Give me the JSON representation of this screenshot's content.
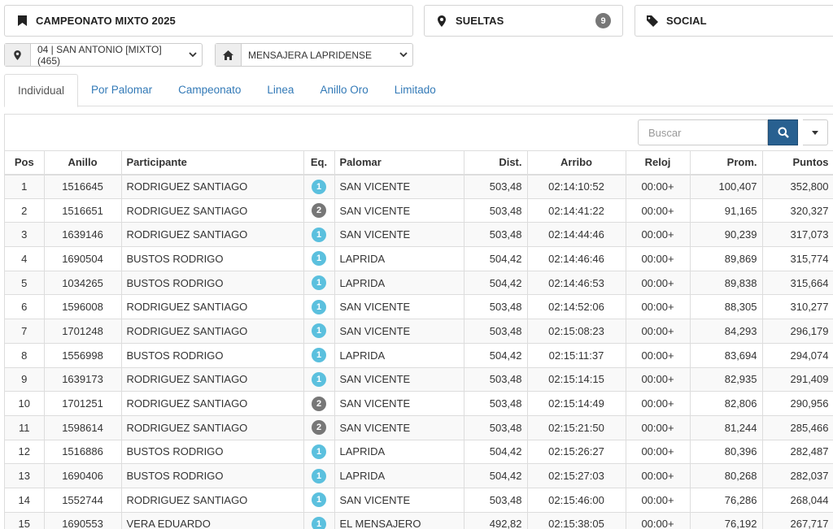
{
  "colors": {
    "link": "#337ab7",
    "primary": "#286090",
    "badge_gray": "#777777",
    "eq1": "#5bc0de",
    "eq2": "#777777"
  },
  "panels": {
    "campeonato": {
      "icon": "bookmark-icon",
      "title": "CAMPEONATO MIXTO 2025"
    },
    "sueltas": {
      "icon": "map-marker-icon",
      "title": "SUELTAS",
      "count": "9"
    },
    "social": {
      "icon": "tag-icon",
      "title": "SOCIAL"
    }
  },
  "selectors": {
    "release": {
      "icon": "map-marker-icon",
      "value": "04 | SAN ANTONIO [MIXTO] (465)"
    },
    "club": {
      "icon": "home-icon",
      "value": "MENSAJERA LAPRIDENSE"
    }
  },
  "tabs": [
    "Individual",
    "Por Palomar",
    "Campeonato",
    "Linea",
    "Anillo Oro",
    "Limitado"
  ],
  "active_tab": "Individual",
  "search": {
    "placeholder": "Buscar"
  },
  "table": {
    "headers": [
      "Pos",
      "Anillo",
      "Participante",
      "Eq.",
      "Palomar",
      "Dist.",
      "Arribo",
      "Reloj",
      "Prom.",
      "Puntos"
    ],
    "rows": [
      [
        "1",
        "1516645",
        "RODRIGUEZ SANTIAGO",
        "1",
        "SAN VICENTE",
        "503,48",
        "02:14:10:52",
        "00:00+",
        "100,407",
        "352,800"
      ],
      [
        "2",
        "1516651",
        "RODRIGUEZ SANTIAGO",
        "2",
        "SAN VICENTE",
        "503,48",
        "02:14:41:22",
        "00:00+",
        "91,165",
        "320,327"
      ],
      [
        "3",
        "1639146",
        "RODRIGUEZ SANTIAGO",
        "1",
        "SAN VICENTE",
        "503,48",
        "02:14:44:46",
        "00:00+",
        "90,239",
        "317,073"
      ],
      [
        "4",
        "1690504",
        "BUSTOS RODRIGO",
        "1",
        "LAPRIDA",
        "504,42",
        "02:14:46:46",
        "00:00+",
        "89,869",
        "315,774"
      ],
      [
        "5",
        "1034265",
        "BUSTOS RODRIGO",
        "1",
        "LAPRIDA",
        "504,42",
        "02:14:46:53",
        "00:00+",
        "89,838",
        "315,664"
      ],
      [
        "6",
        "1596008",
        "RODRIGUEZ SANTIAGO",
        "1",
        "SAN VICENTE",
        "503,48",
        "02:14:52:06",
        "00:00+",
        "88,305",
        "310,277"
      ],
      [
        "7",
        "1701248",
        "RODRIGUEZ SANTIAGO",
        "1",
        "SAN VICENTE",
        "503,48",
        "02:15:08:23",
        "00:00+",
        "84,293",
        "296,179"
      ],
      [
        "8",
        "1556998",
        "BUSTOS RODRIGO",
        "1",
        "LAPRIDA",
        "504,42",
        "02:15:11:37",
        "00:00+",
        "83,694",
        "294,074"
      ],
      [
        "9",
        "1639173",
        "RODRIGUEZ SANTIAGO",
        "1",
        "SAN VICENTE",
        "503,48",
        "02:15:14:15",
        "00:00+",
        "82,935",
        "291,409"
      ],
      [
        "10",
        "1701251",
        "RODRIGUEZ SANTIAGO",
        "2",
        "SAN VICENTE",
        "503,48",
        "02:15:14:49",
        "00:00+",
        "82,806",
        "290,956"
      ],
      [
        "11",
        "1598614",
        "RODRIGUEZ SANTIAGO",
        "2",
        "SAN VICENTE",
        "503,48",
        "02:15:21:50",
        "00:00+",
        "81,244",
        "285,466"
      ],
      [
        "12",
        "1516886",
        "BUSTOS RODRIGO",
        "1",
        "LAPRIDA",
        "504,42",
        "02:15:26:27",
        "00:00+",
        "80,396",
        "282,487"
      ],
      [
        "13",
        "1690406",
        "BUSTOS RODRIGO",
        "1",
        "LAPRIDA",
        "504,42",
        "02:15:27:03",
        "00:00+",
        "80,268",
        "282,037"
      ],
      [
        "14",
        "1552744",
        "RODRIGUEZ SANTIAGO",
        "1",
        "SAN VICENTE",
        "503,48",
        "02:15:46:00",
        "00:00+",
        "76,286",
        "268,044"
      ],
      [
        "15",
        "1690553",
        "VERA EDUARDO",
        "1",
        "EL MENSAJERO",
        "492,82",
        "02:15:38:05",
        "00:00+",
        "76,192",
        "267,717"
      ]
    ]
  }
}
